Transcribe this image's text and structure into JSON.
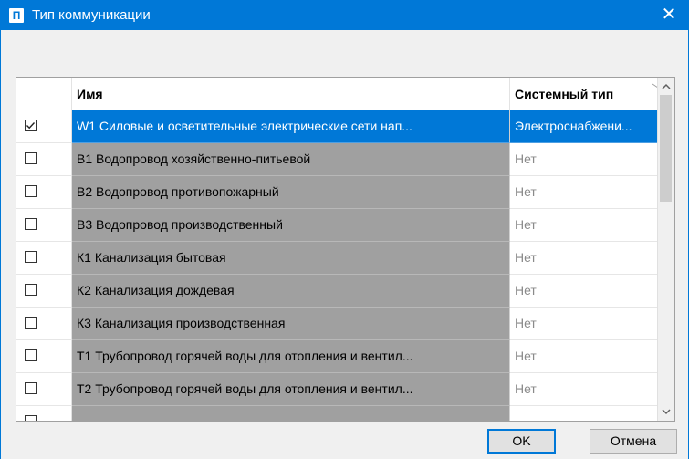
{
  "window": {
    "title": "Тип коммуникации",
    "icon_letter": "П",
    "icon": "app-icon",
    "close_glyph": "✕",
    "accent": "#0078d7"
  },
  "table": {
    "columns": [
      {
        "label": ""
      },
      {
        "label": "Имя"
      },
      {
        "label": "Системный тип"
      }
    ],
    "rows": [
      {
        "checked": true,
        "name": "W1 Силовые и осветительные электрические сети нап...",
        "type": "Электроснабжени...",
        "selected": true
      },
      {
        "checked": false,
        "name": "В1 Водопровод хозяйственно-питьевой",
        "type": "Нет",
        "selected": false
      },
      {
        "checked": false,
        "name": "В2 Водопровод противопожарный",
        "type": "Нет",
        "selected": false
      },
      {
        "checked": false,
        "name": "В3 Водопровод производственный",
        "type": "Нет",
        "selected": false
      },
      {
        "checked": false,
        "name": "К1 Канализация бытовая",
        "type": "Нет",
        "selected": false
      },
      {
        "checked": false,
        "name": "К2 Канализация дождевая",
        "type": "Нет",
        "selected": false
      },
      {
        "checked": false,
        "name": "К3 Канализация производственная",
        "type": "Нет",
        "selected": false
      },
      {
        "checked": false,
        "name": "Т1 Трубопровод горячей воды для отопления и вентил...",
        "type": "Нет",
        "selected": false
      },
      {
        "checked": false,
        "name": "Т2 Трубопровод горячей воды для отопления и вентил...",
        "type": "Нет",
        "selected": false
      },
      {
        "checked": false,
        "name": "",
        "type": "",
        "selected": false
      }
    ]
  },
  "buttons": {
    "ok": "OK",
    "cancel": "Отмена"
  }
}
